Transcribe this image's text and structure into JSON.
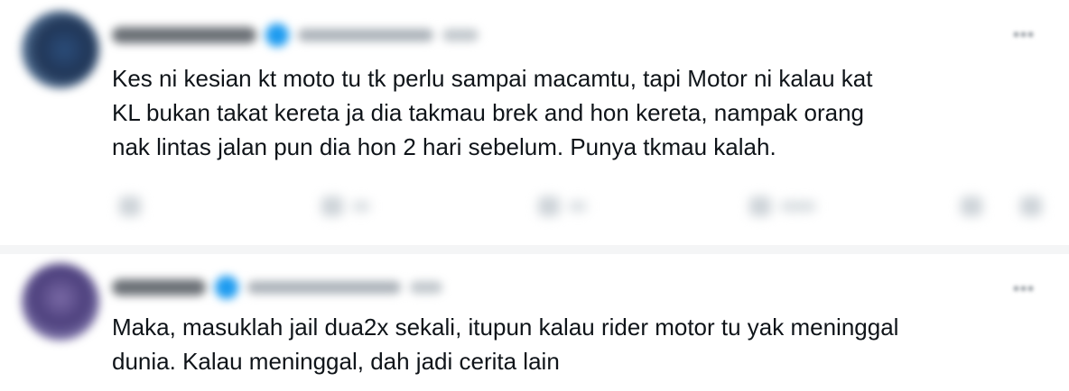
{
  "tweets": [
    {
      "text_lines": [
        "Kes ni kesian kt moto tu tk perlu sampai macamtu, tapi Motor ni kalau kat",
        "KL bukan takat kereta ja dia takmau brek and hon kereta, nampak orang",
        "nak lintas jalan pun dia hon 2 hari sebelum. Punya tkmau kalah."
      ],
      "verified_color": "#1d9bf0",
      "action_icons": [
        "reply-icon",
        "retweet-icon",
        "like-icon",
        "views-icon",
        "bookmark-icon",
        "share-icon"
      ]
    },
    {
      "text_lines": [
        "Maka, masuklah jail dua2x sekali, itupun kalau rider motor tu yak meninggal",
        "dunia. Kalau meninggal, dah jadi cerita lain"
      ],
      "verified_color": "#1d9bf0"
    }
  ],
  "more_icon": "more-options-icon"
}
